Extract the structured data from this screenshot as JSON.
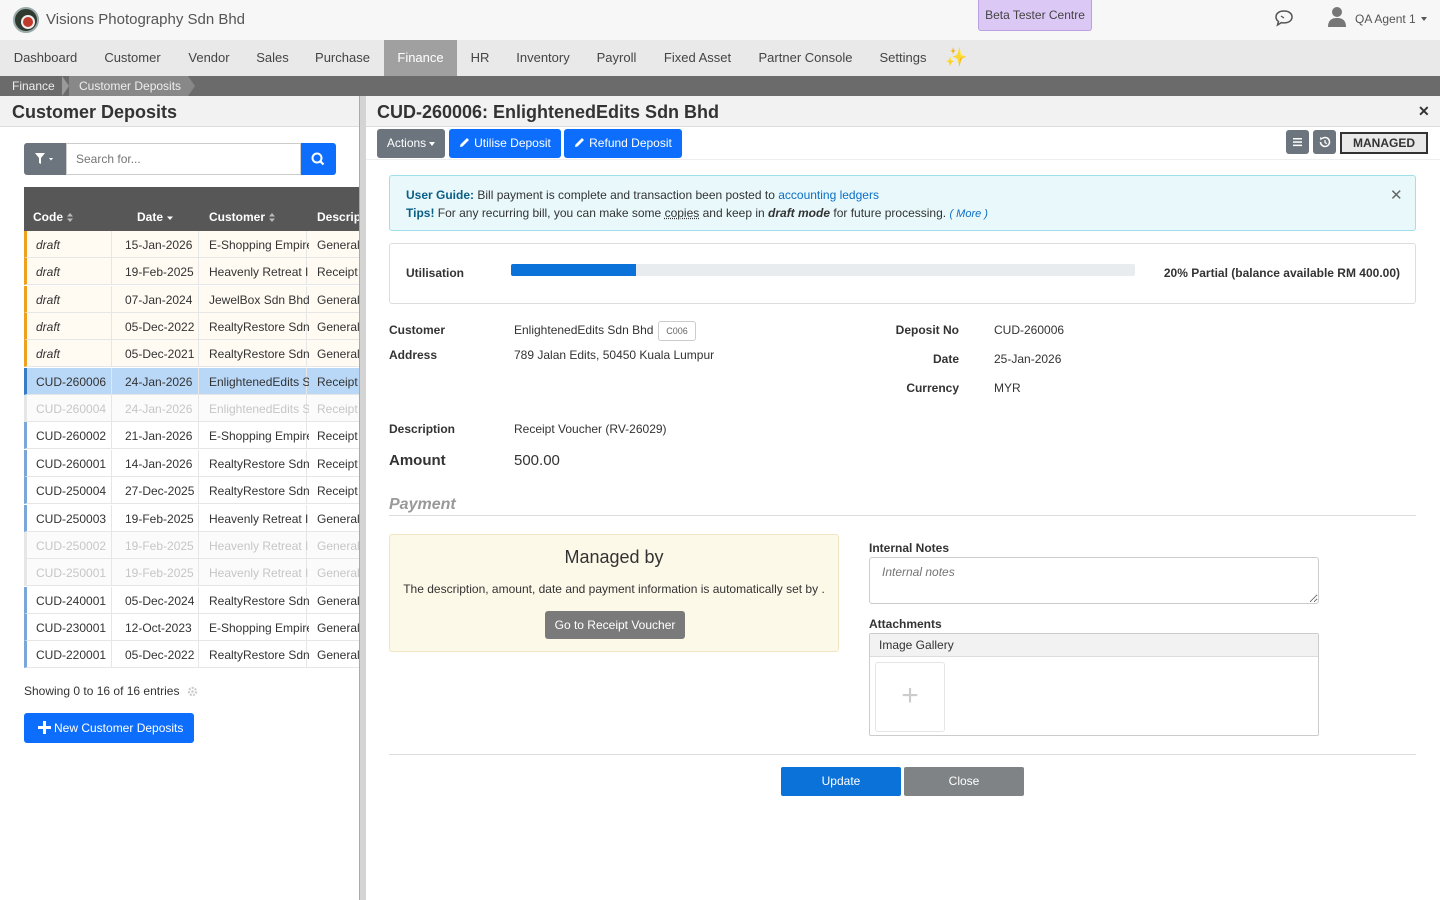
{
  "app": {
    "company": "Visions Photography Sdn Bhd",
    "beta_label": "Beta Tester Centre",
    "user_name": "QA Agent 1"
  },
  "nav": {
    "items": [
      "Dashboard",
      "Customer",
      "Vendor",
      "Sales",
      "Purchase",
      "Finance",
      "HR",
      "Inventory",
      "Payroll",
      "Fixed Asset",
      "Partner Console",
      "Settings"
    ],
    "active": "Finance",
    "sparkle": "✨"
  },
  "breadcrumb": [
    "Finance",
    "Customer Deposits"
  ],
  "list": {
    "title": "Customer Deposits",
    "search_placeholder": "Search for...",
    "columns": [
      "Code",
      "Date",
      "Customer",
      "Descrip"
    ],
    "rows": [
      {
        "code": "draft",
        "date": "15-Jan-2026",
        "customer": "E-Shopping Empire",
        "desc": "General",
        "state": "draft"
      },
      {
        "code": "draft",
        "date": "19-Feb-2025",
        "customer": "Heavenly Retreat Inn",
        "desc": "Receipt",
        "state": "draft"
      },
      {
        "code": "draft",
        "date": "07-Jan-2024",
        "customer": "JewelBox Sdn Bhd",
        "desc": "General",
        "state": "draft"
      },
      {
        "code": "draft",
        "date": "05-Dec-2022",
        "customer": "RealtyRestore Sdn Bhd",
        "desc": "General",
        "state": "draft"
      },
      {
        "code": "draft",
        "date": "05-Dec-2021",
        "customer": "RealtyRestore Sdn Bhd",
        "desc": "General",
        "state": "draft"
      },
      {
        "code": "CUD-260006",
        "date": "24-Jan-2026",
        "customer": "EnlightenedEdits Sdn Bhd",
        "desc": "Receipt",
        "state": "selected"
      },
      {
        "code": "CUD-260004",
        "date": "24-Jan-2026",
        "customer": "EnlightenedEdits Sdn Bhd",
        "desc": "Receipt",
        "state": "dim"
      },
      {
        "code": "CUD-260002",
        "date": "21-Jan-2026",
        "customer": "E-Shopping Empire",
        "desc": "Receipt",
        "state": "normal"
      },
      {
        "code": "CUD-260001",
        "date": "14-Jan-2026",
        "customer": "RealtyRestore Sdn Bhd",
        "desc": "Receipt",
        "state": "normal"
      },
      {
        "code": "CUD-250004",
        "date": "27-Dec-2025",
        "customer": "RealtyRestore Sdn Bhd",
        "desc": "Receipt",
        "state": "normal"
      },
      {
        "code": "CUD-250003",
        "date": "19-Feb-2025",
        "customer": "Heavenly Retreat Inn",
        "desc": "General",
        "state": "normal"
      },
      {
        "code": "CUD-250002",
        "date": "19-Feb-2025",
        "customer": "Heavenly Retreat Inn",
        "desc": "General",
        "state": "dim"
      },
      {
        "code": "CUD-250001",
        "date": "19-Feb-2025",
        "customer": "Heavenly Retreat Inn",
        "desc": "General",
        "state": "dim"
      },
      {
        "code": "CUD-240001",
        "date": "05-Dec-2024",
        "customer": "RealtyRestore Sdn Bhd",
        "desc": "General",
        "state": "normal"
      },
      {
        "code": "CUD-230001",
        "date": "12-Oct-2023",
        "customer": "E-Shopping Empire",
        "desc": "General",
        "state": "normal"
      },
      {
        "code": "CUD-220001",
        "date": "05-Dec-2022",
        "customer": "RealtyRestore Sdn Bhd",
        "desc": "General",
        "state": "normal"
      }
    ],
    "showing": "Showing 0 to 16 of 16 entries",
    "new_button": "New Customer Deposits"
  },
  "detail": {
    "title": "CUD-260006: EnlightenedEdits Sdn Bhd",
    "actions_label": "Actions",
    "utilise_label": "Utilise Deposit",
    "refund_label": "Refund Deposit",
    "managed_badge": "MANAGED",
    "guide": {
      "label": "User Guide:",
      "text1": "Bill payment is complete and transaction been posted to",
      "link": "accounting ledgers",
      "tips_label": "Tips!",
      "tips_a": "For any recurring bill, you can make some",
      "tips_copies": "copies",
      "tips_b": "and keep in",
      "tips_draft": "draft mode",
      "tips_c": "for future processing.",
      "more": "( More )"
    },
    "utilisation": {
      "label": "Utilisation",
      "percent": 20,
      "text": "20% Partial (balance available RM 400.00)"
    },
    "customer_label": "Customer",
    "customer": "EnlightenedEdits Sdn Bhd",
    "customer_code": "C006",
    "address_label": "Address",
    "address": "789 Jalan Edits, 50450 Kuala Lumpur",
    "deposit_no_label": "Deposit No",
    "deposit_no": "CUD-260006",
    "date_label": "Date",
    "date": "25-Jan-2026",
    "currency_label": "Currency",
    "currency": "MYR",
    "description_label": "Description",
    "description": "Receipt Voucher (RV-26029)",
    "amount_label": "Amount",
    "amount": "500.00",
    "payment_title": "Payment",
    "managed_by": {
      "title": "Managed by",
      "text": "The description, amount, date and payment information is automatically set by .",
      "button": "Go to Receipt Voucher"
    },
    "notes_label": "Internal Notes",
    "notes_placeholder": "Internal notes",
    "attachments_label": "Attachments",
    "gallery_label": "Image Gallery",
    "gallery_add": "+",
    "update_label": "Update",
    "close_label": "Close"
  }
}
